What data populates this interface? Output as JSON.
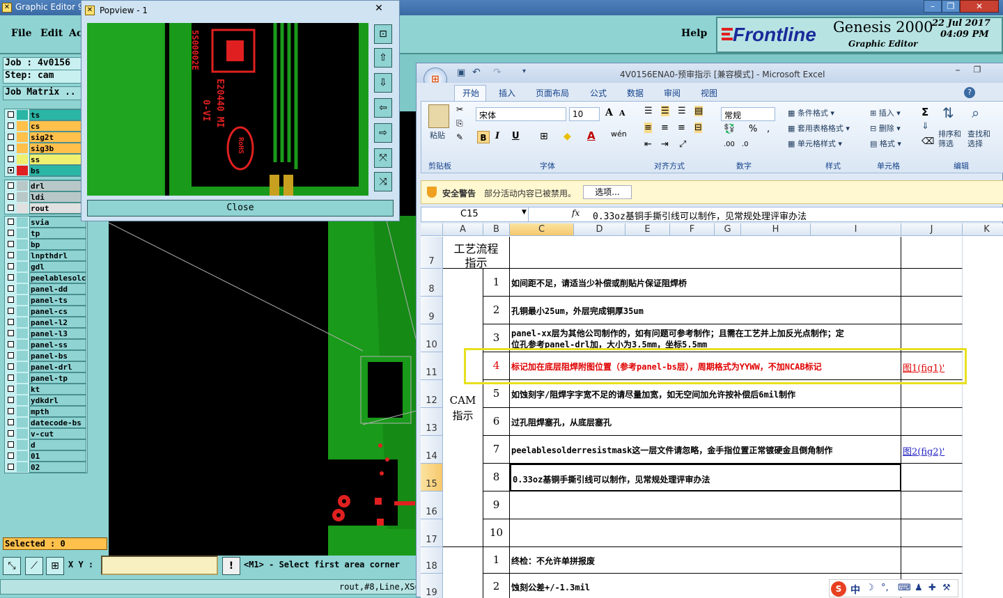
{
  "genesis": {
    "window_title": "Graphic Editor 9",
    "menu": {
      "file": "File",
      "edit": "Edit",
      "actions": "Ac",
      "help": "Help"
    },
    "brand": {
      "logo": "Frontline",
      "product": "Genesis 2000",
      "subtitle": "Graphic Editor",
      "date": "22 Jul 2017",
      "time": "04:09 PM"
    },
    "job": "Job : 4v0156",
    "step": "Step: cam",
    "job_matrix": "Job Matrix ..",
    "layer_groups": [
      [
        {
          "name": "ts",
          "bg": "#2ab5a5",
          "color": "#2ab5a5",
          "checked": false
        },
        {
          "name": "cs",
          "bg": "#ffc04c",
          "color": "#ffc04c",
          "checked": false
        },
        {
          "name": "sig2t",
          "bg": "#ffc04c",
          "color": "#ffc04c",
          "checked": false
        },
        {
          "name": "sig3b",
          "bg": "#ffc04c",
          "color": "#ffc04c",
          "checked": false
        },
        {
          "name": "ss",
          "bg": "#f0f070",
          "color": "#f0f070",
          "checked": false
        },
        {
          "name": "bs",
          "bg": "#2ab5a5",
          "color": "#e02020",
          "checked": true
        }
      ],
      [
        {
          "name": "drl",
          "bg": "#b8c8c8",
          "color": "#b8c8c8",
          "checked": false
        },
        {
          "name": "ldi",
          "bg": "#b8c8c8",
          "color": "#b8c8c8",
          "checked": false
        },
        {
          "name": "rout",
          "bg": "#e0e0e0",
          "color": "#e0e0e0",
          "checked": false
        }
      ],
      [
        {
          "name": "svia",
          "bg": "#8fd3d3",
          "color": "#8fd3d3",
          "checked": false
        },
        {
          "name": "tp",
          "bg": "#8fd3d3",
          "color": "#8fd3d3",
          "checked": false
        },
        {
          "name": "bp",
          "bg": "#8fd3d3",
          "color": "#8fd3d3",
          "checked": false
        },
        {
          "name": "lnpthdrl",
          "bg": "#8fd3d3",
          "color": "#8fd3d3",
          "checked": false
        },
        {
          "name": "gdl",
          "bg": "#8fd3d3",
          "color": "#8fd3d3",
          "checked": false
        },
        {
          "name": "peelablesolc",
          "bg": "#8fd3d3",
          "color": "#8fd3d3",
          "checked": false
        },
        {
          "name": "panel-dd",
          "bg": "#8fd3d3",
          "color": "#8fd3d3",
          "checked": false
        },
        {
          "name": "panel-ts",
          "bg": "#8fd3d3",
          "color": "#8fd3d3",
          "checked": false
        },
        {
          "name": "panel-cs",
          "bg": "#8fd3d3",
          "color": "#8fd3d3",
          "checked": false
        },
        {
          "name": "panel-l2",
          "bg": "#8fd3d3",
          "color": "#8fd3d3",
          "checked": false
        },
        {
          "name": "panel-l3",
          "bg": "#8fd3d3",
          "color": "#8fd3d3",
          "checked": false
        },
        {
          "name": "panel-ss",
          "bg": "#8fd3d3",
          "color": "#8fd3d3",
          "checked": false
        },
        {
          "name": "panel-bs",
          "bg": "#8fd3d3",
          "color": "#8fd3d3",
          "checked": false
        },
        {
          "name": "panel-drl",
          "bg": "#8fd3d3",
          "color": "#8fd3d3",
          "checked": false
        },
        {
          "name": "panel-tp",
          "bg": "#8fd3d3",
          "color": "#8fd3d3",
          "checked": false
        },
        {
          "name": "kt",
          "bg": "#8fd3d3",
          "color": "#8fd3d3",
          "checked": false
        },
        {
          "name": "ydkdrl",
          "bg": "#8fd3d3",
          "color": "#8fd3d3",
          "checked": false
        },
        {
          "name": "mpth",
          "bg": "#8fd3d3",
          "color": "#8fd3d3",
          "checked": false
        },
        {
          "name": "datecode-bs",
          "bg": "#8fd3d3",
          "color": "#8fd3d3",
          "checked": false
        },
        {
          "name": "v-cut",
          "bg": "#8fd3d3",
          "color": "#8fd3d3",
          "checked": false
        },
        {
          "name": "d",
          "bg": "#8fd3d3",
          "color": "#8fd3d3",
          "checked": false
        },
        {
          "name": "01",
          "bg": "#8fd3d3",
          "color": "#8fd3d3",
          "checked": false
        },
        {
          "name": "02",
          "bg": "#8fd3d3",
          "color": "#8fd3d3",
          "checked": false
        }
      ]
    ],
    "selected": "Selected : 0",
    "xy_label": "X Y :",
    "xy_value": "",
    "prompt": "<M1> - Select first area corner",
    "status": "rout,#8,Line,XS="
  },
  "popview": {
    "title": "Popview - 1",
    "close": "Close",
    "board_text": {
      "part": "E20440 MI",
      "code": "0-VI",
      "serial": "5S00002E",
      "rohs": "RoHS"
    }
  },
  "excel": {
    "title": "4V0156ENA0-预审指示 [兼容模式] - Microsoft Excel",
    "tabs": [
      "开始",
      "插入",
      "页面布局",
      "公式",
      "数据",
      "审阅",
      "视图"
    ],
    "ribbon": {
      "paste": "粘贴",
      "clipboard": "剪贴板",
      "font_name": "宋体",
      "font_size": "10",
      "font": "字体",
      "alignment": "对齐方式",
      "number_format": "常规",
      "number": "数字",
      "cond_format": "条件格式",
      "table_format": "套用表格格式",
      "cell_style": "单元格样式",
      "styles": "样式",
      "insert": "插入",
      "delete": "删除",
      "format": "格式",
      "cells": "单元格",
      "sort_filter": "排序和筛选",
      "find_select": "查找和选择",
      "editing": "编辑"
    },
    "security": {
      "label": "安全警告",
      "message": "部分活动内容已被禁用。",
      "button": "选项..."
    },
    "formula_bar": {
      "name_box": "C15",
      "fx": "fx",
      "content": "0.33oz基铜手撕引线可以制作，见常规处理评审办法"
    },
    "columns": [
      "A",
      "B",
      "C",
      "D",
      "E",
      "F",
      "G",
      "H",
      "I",
      "J",
      "K"
    ],
    "rows": [
      {
        "n": "7",
        "num": "",
        "text": "",
        "link": ""
      },
      {
        "n": "8",
        "num": "1",
        "text": "如间距不足，请适当少补偿或削贴片保证阻焊桥",
        "link": ""
      },
      {
        "n": "9",
        "num": "2",
        "text": "孔铜最小25um，外层完成铜厚35um",
        "link": ""
      },
      {
        "n": "10",
        "num": "3",
        "text": "panel-xx层为其他公司制作的，如有问题可参考制作；且需在工艺并上加反光点制作；定",
        "text2": "位孔参考panel-drl加，大小为3.5mm，坐标5.5mm",
        "link": ""
      },
      {
        "n": "11",
        "num": "4",
        "text": "标记加在底层阻焊附图位置（参考panel-bs层），周期格式为YYWW，不加NCAB标记",
        "link": "图1(fig1)'"
      },
      {
        "n": "12",
        "num": "5",
        "text": "如蚀刻字/阻焊字字宽不足的请尽量加宽，如无空间加允许按补偿后6mil制作",
        "link": ""
      },
      {
        "n": "13",
        "num": "6",
        "text": "过孔阻焊塞孔，从底层塞孔",
        "link": ""
      },
      {
        "n": "14",
        "num": "7",
        "text": "peelablesolderresistmask这一层文件请忽略，金手指位置正常镀硬金且倒角制作",
        "link": "图2(fig2)'"
      },
      {
        "n": "15",
        "num": "8",
        "text": "0.33oz基铜手撕引线可以制作，见常规处理评审办法",
        "link": ""
      },
      {
        "n": "16",
        "num": "9",
        "text": "",
        "link": ""
      },
      {
        "n": "17",
        "num": "10",
        "text": "",
        "link": ""
      },
      {
        "n": "18",
        "num": "1",
        "text": "终检：不允许单拼报废",
        "link": ""
      },
      {
        "n": "19",
        "num": "2",
        "text": "蚀刻公差+/-1.3mil",
        "link": ""
      }
    ],
    "section_header": "工艺流程指示",
    "section_header_l1": "工艺流程",
    "section_header_l2": "指示",
    "cam_l1": "CAM",
    "cam_l2": "指示",
    "ime": "中"
  },
  "colors": {
    "highlight": "#e8e020",
    "red_text": "#e00000",
    "link": "#2020c0",
    "pcb_green": "#1a9a1a"
  }
}
